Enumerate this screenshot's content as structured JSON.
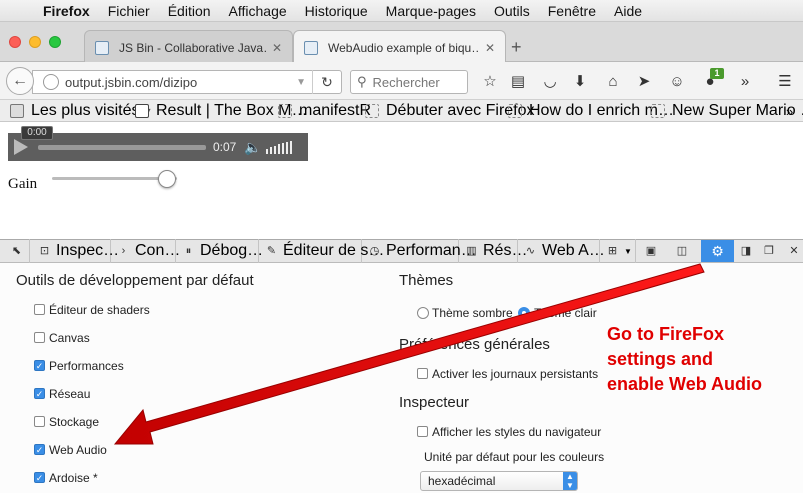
{
  "menubar": {
    "items": [
      "Firefox",
      "Fichier",
      "Édition",
      "Affichage",
      "Historique",
      "Marque-pages",
      "Outils",
      "Fenêtre",
      "Aide"
    ]
  },
  "tabs": [
    {
      "title": "JS Bin - Collaborative Java…",
      "active": false
    },
    {
      "title": "WebAudio example of biqu…",
      "active": true
    }
  ],
  "navbar": {
    "url": "output.jsbin.com/dizipo",
    "search_placeholder": "Rechercher",
    "badge": "1"
  },
  "bookmarks": [
    "Les plus visités",
    "Result | The Box M…",
    "manifestR",
    "Débuter avec Firefox",
    "How do I enrich m…",
    "New Super Mario …"
  ],
  "page": {
    "tooltip_time": "0:00",
    "duration": "0:07",
    "gain_label": "Gain",
    "gain_level": 0.92
  },
  "devtools": {
    "tabs": [
      "Inspec…",
      "Con…",
      "Débog…",
      "Éditeur de s…",
      "Performan…",
      "Rés…",
      "Web A…"
    ],
    "options": {
      "left_heading": "Outils de développement par défaut",
      "tools": [
        {
          "label": "Éditeur de shaders",
          "checked": false
        },
        {
          "label": "Canvas",
          "checked": false
        },
        {
          "label": "Performances",
          "checked": true
        },
        {
          "label": "Réseau",
          "checked": true
        },
        {
          "label": "Stockage",
          "checked": false
        },
        {
          "label": "Web Audio",
          "checked": true
        },
        {
          "label": "Ardoise *",
          "checked": true
        }
      ],
      "themes_heading": "Thèmes",
      "theme_dark": "Thème sombre",
      "theme_light": "Thème clair",
      "theme_selected": "light",
      "prefs_heading": "Préférences générales",
      "persist_logs": "Activer les journaux persistants",
      "inspector_heading": "Inspecteur",
      "browser_styles": "Afficher les styles du navigateur",
      "color_unit_label": "Unité par défaut pour les couleurs",
      "color_unit_value": "hexadécimal"
    }
  },
  "annotation": {
    "lines": [
      "Go to FireFox",
      "settings and",
      "enable Web Audio"
    ],
    "color": "#e00000"
  }
}
